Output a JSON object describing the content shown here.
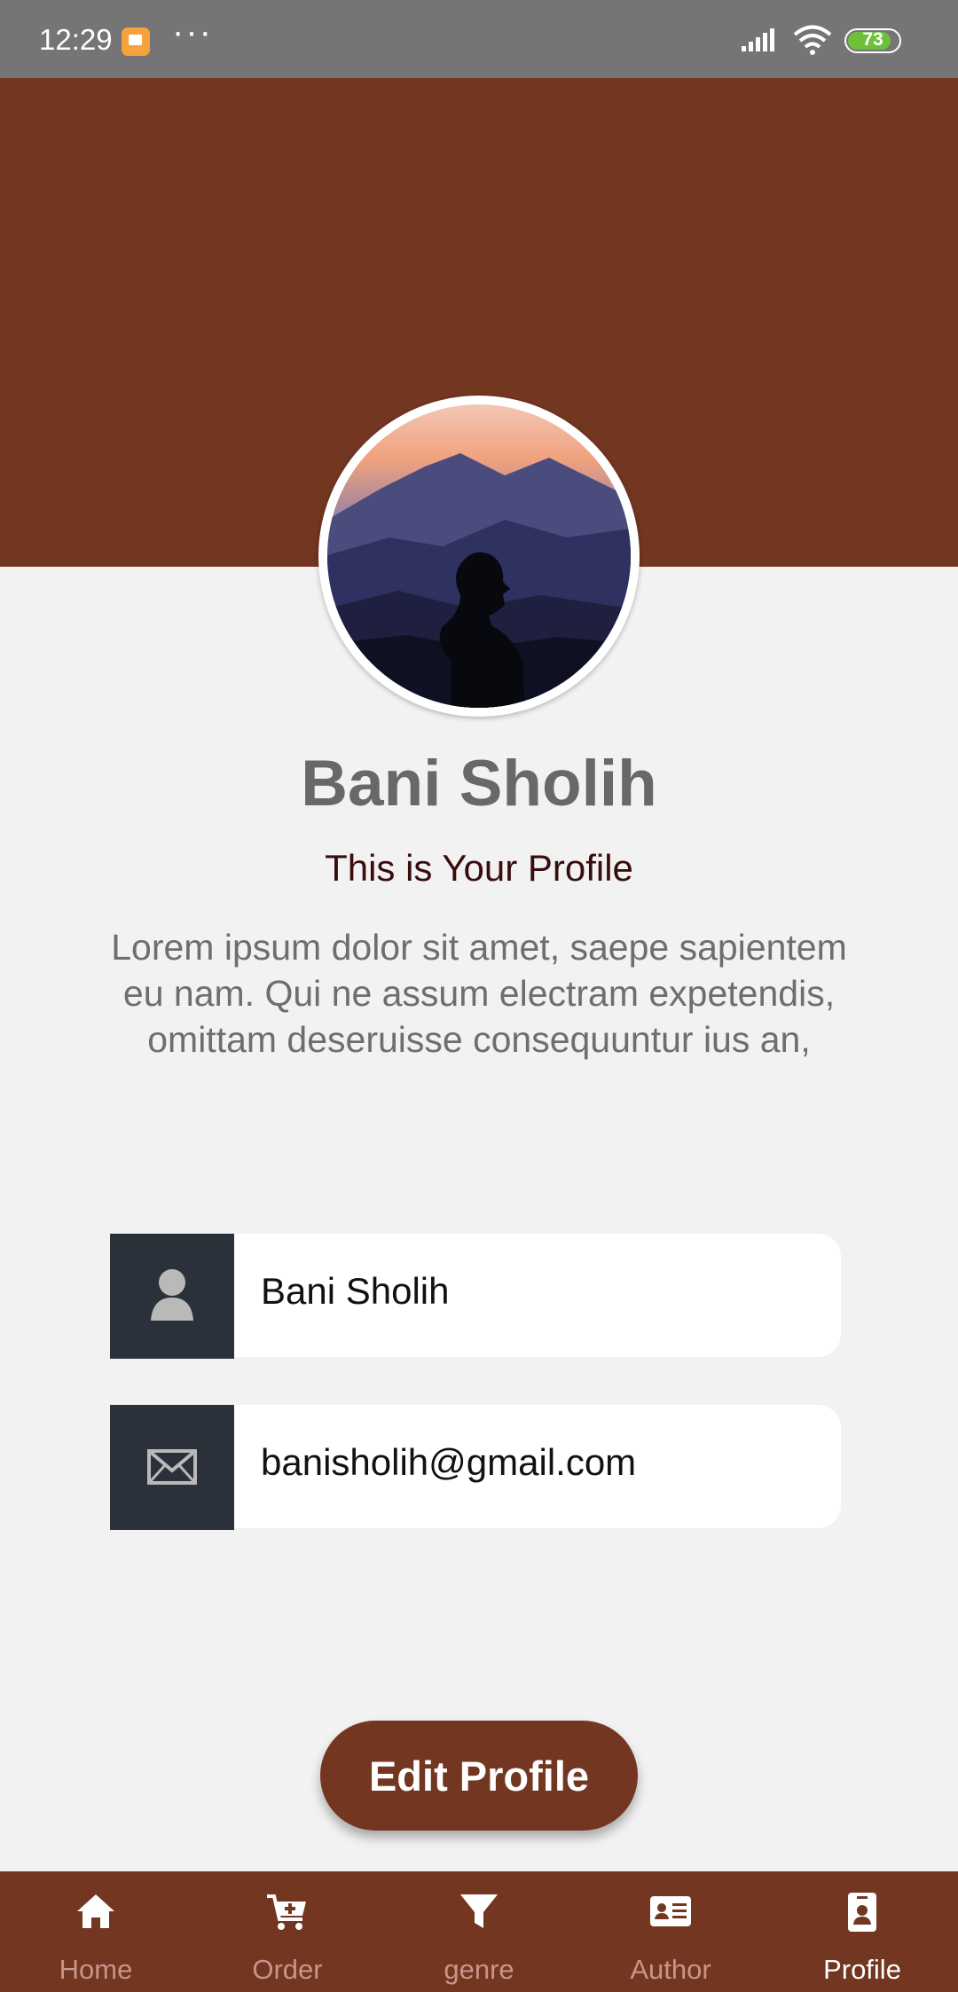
{
  "status_bar": {
    "time": "12:29",
    "dots": "···",
    "battery": "73",
    "icons": [
      "notification-icon",
      "signal-icon",
      "wifi-icon",
      "battery-icon"
    ]
  },
  "colors": {
    "primary": "#723621",
    "background": "#f2f2f2",
    "icon_box": "#2b313a",
    "status_bar": "#757575"
  },
  "profile": {
    "name": "Bani Sholih",
    "subtitle": "This is Your Profile",
    "description_lines": [
      "Lorem ipsum dolor sit amet, saepe sapientem",
      "eu nam. Qui ne assum electram expetendis,",
      "omittam deseruisse consequuntur ius an,"
    ]
  },
  "fields": {
    "name": {
      "icon": "user-icon",
      "value": "Bani Sholih"
    },
    "email": {
      "icon": "mail-icon",
      "value": "banisholih@gmail.com"
    }
  },
  "edit_button": {
    "label": "Edit Profile"
  },
  "nav": {
    "items": [
      {
        "label": "Home",
        "icon": "home-icon"
      },
      {
        "label": "Order",
        "icon": "cart-add-icon"
      },
      {
        "label": "genre",
        "icon": "filter-icon"
      },
      {
        "label": "Author",
        "icon": "id-card-icon"
      },
      {
        "label": "Profile",
        "icon": "badge-icon"
      }
    ],
    "active": "Profile"
  }
}
